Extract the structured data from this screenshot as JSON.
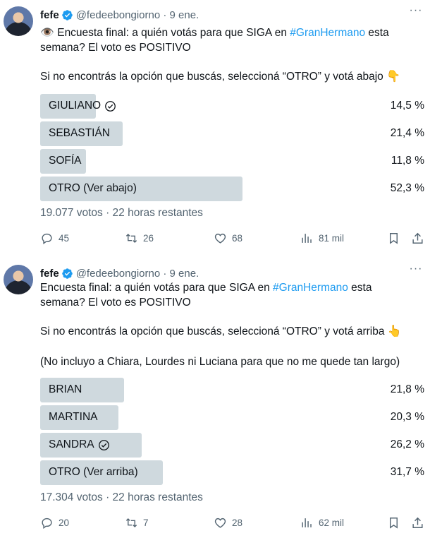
{
  "tweets": [
    {
      "author": {
        "name": "fefe",
        "handle": "@fedeebongiorno",
        "date": "9 ene."
      },
      "text": {
        "line1_emoji": "👁️",
        "line1_pre": " Encuesta final: a quién votás para que SIGA en ",
        "hashtag": "#GranHermano",
        "line1_post": " esta",
        "line2": "semana? El voto es POSITIVO",
        "line3_pre": "Si no encontrás la opción que buscás, seleccioná “OTRO” y votá abajo ",
        "line3_emoji": "👇"
      },
      "poll": {
        "options": [
          {
            "label": "GIULIANO",
            "percent": "14,5 %",
            "share": 0.145,
            "winner": true
          },
          {
            "label": "SEBASTIÁN",
            "percent": "21,4 %",
            "share": 0.214,
            "winner": false
          },
          {
            "label": "SOFÍA",
            "percent": "11,8 %",
            "share": 0.118,
            "winner": false
          },
          {
            "label": "OTRO (Ver abajo)",
            "percent": "52,3 %",
            "share": 0.523,
            "winner": false
          }
        ],
        "votes": "19.077 votos",
        "separator": " · ",
        "remaining": "22 horas restantes"
      },
      "actions": {
        "replies": "45",
        "reposts": "26",
        "likes": "68",
        "views": "81 mil"
      }
    },
    {
      "author": {
        "name": "fefe",
        "handle": "@fedeebongiorno",
        "date": "9 ene."
      },
      "text": {
        "line1_pre": "Encuesta final: a quién votás para que SIGA en ",
        "hashtag": "#GranHermano",
        "line1_post": " esta",
        "line2": "semana? El voto es POSITIVO",
        "line3_pre": "Si no encontrás la opción que buscás, seleccioná “OTRO” y votá arriba ",
        "line3_emoji": "👆",
        "line4": "(No incluyo a Chiara, Lourdes ni Luciana para que no me quede tan largo)"
      },
      "poll": {
        "options": [
          {
            "label": "BRIAN",
            "percent": "21,8 %",
            "share": 0.218,
            "winner": false
          },
          {
            "label": "MARTINA",
            "percent": "20,3 %",
            "share": 0.203,
            "winner": false
          },
          {
            "label": "SANDRA",
            "percent": "26,2 %",
            "share": 0.262,
            "winner": true
          },
          {
            "label": "OTRO (Ver arriba)",
            "percent": "31,7 %",
            "share": 0.317,
            "winner": false
          }
        ],
        "votes": "17.304 votos",
        "separator": " · ",
        "remaining": "22 horas restantes"
      },
      "actions": {
        "replies": "20",
        "reposts": "7",
        "likes": "28",
        "views": "62 mil"
      }
    }
  ],
  "icons": {
    "verified": "verified-badge-icon",
    "more": "more-options-icon",
    "reply": "reply-icon",
    "repost": "repost-icon",
    "like": "like-icon",
    "views": "views-icon",
    "bookmark": "bookmark-icon",
    "share": "share-icon",
    "check": "check-circle-icon"
  },
  "colors": {
    "accent": "#1d9bf0",
    "bar": "#cfd9de",
    "muted": "#536471",
    "text": "#0f1419"
  }
}
